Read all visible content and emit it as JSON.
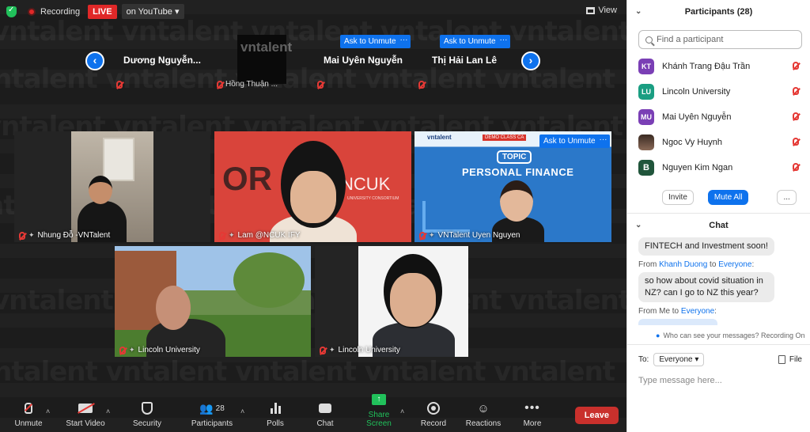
{
  "top_bar": {
    "recording_label": "Recording",
    "live_label": "LIVE",
    "youtube_label": "on YouTube",
    "view_label": "View"
  },
  "strip": {
    "ask_label": "Ask to Unmute",
    "more_label": "···",
    "tiles": [
      {
        "name": "Dương  Nguyễn...",
        "label": ""
      },
      {
        "name": "",
        "label": "Hồng Thuận ..."
      },
      {
        "name": "Mai Uyên Nguyễn",
        "label": ""
      },
      {
        "name": "Thị Hải Lan Lê",
        "label": ""
      }
    ]
  },
  "tiles": [
    {
      "label": "Nhung Đỗ -VNTalent"
    },
    {
      "label": "Lam @NCUK IFY",
      "banner_left": "OR",
      "banner_right": "NCUK",
      "banner_sub": "UNIVERSITY CONSORTIUM"
    },
    {
      "label": "VNTalent Uyen Nguyen",
      "slide_topic": "TOPIC",
      "slide_title": "PERSONAL FINANCE",
      "slide_brand": "vntalent",
      "slide_tag": "DEMO CLASS CA",
      "ask_label": "Ask to Unmute"
    },
    {
      "label": "Lincoln University"
    },
    {
      "label": "Lincoln University"
    }
  ],
  "toolbar": {
    "unmute": "Unmute",
    "start_video": "Start Video",
    "security": "Security",
    "participants": "Participants",
    "participants_count": "28",
    "polls": "Polls",
    "chat": "Chat",
    "share_screen": "Share Screen",
    "record": "Record",
    "reactions": "Reactions",
    "more": "More",
    "leave": "Leave"
  },
  "participants_panel": {
    "title": "Participants (28)",
    "search_placeholder": "Find a participant",
    "list": [
      {
        "initials": "KT",
        "name": "Khánh Trang Đậu Trần",
        "color": "#7a3fb5"
      },
      {
        "initials": "LU",
        "name": "Lincoln University",
        "color": "#1a9e82"
      },
      {
        "initials": "MU",
        "name": "Mai Uyên Nguyễn",
        "color": "#7a3fb5"
      },
      {
        "initials": "",
        "name": "Ngoc Vy Huynh",
        "color": "#6b4b3e"
      },
      {
        "initials": "B",
        "name": "Nguyen Kim Ngan",
        "color": "#20553b"
      }
    ],
    "invite": "Invite",
    "mute_all": "Mute All",
    "more": "..."
  },
  "chat_panel": {
    "title": "Chat",
    "msg1": "FINTECH and Investment soon!",
    "from2_prefix": "From ",
    "from2_sender": "Khanh Duong",
    "from2_to": " to ",
    "from2_target": "Everyone",
    "from2_suffix": ":",
    "msg2": "so how about covid situation in NZ? can I go to NZ this year?",
    "from3_prefix": "From Me to ",
    "from3_target": "Everyone",
    "from3_suffix": ":",
    "privacy": "Who can see your messages? Recording On",
    "to_label": "To:",
    "to_value": "Everyone",
    "file_label": "File",
    "input_placeholder": "Type message here..."
  },
  "colors": {
    "accent": "#0e72ed",
    "live": "#e02828",
    "leave": "#c9302c",
    "mic_off": "#e53935",
    "share": "#21c15b"
  },
  "icons": [
    "shield-icon",
    "recording-icon",
    "grid-icon",
    "chevron-left-icon",
    "chevron-right-icon",
    "mic-off-icon",
    "pin-icon",
    "video-off-icon",
    "security-icon",
    "participants-icon",
    "polls-icon",
    "chat-icon",
    "share-screen-icon",
    "record-icon",
    "reactions-icon",
    "more-icon",
    "search-icon",
    "file-icon"
  ]
}
